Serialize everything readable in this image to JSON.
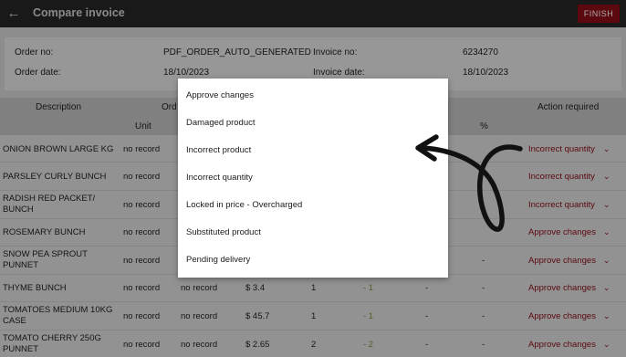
{
  "appbar": {
    "back_icon": "arrow-left-icon",
    "title": "Compare invoice",
    "finish_label": "FINISH"
  },
  "summary": {
    "order_no_label": "Order no:",
    "order_no": "PDF_ORDER_AUTO_GENERATED",
    "invoice_no_label": "Invoice no:",
    "invoice_no": "6234270",
    "order_date_label": "Order date:",
    "order_date": "18/10/2023",
    "invoice_date_label": "Invoice date:",
    "invoice_date": "18/10/2023"
  },
  "table": {
    "headers": {
      "description": "Description",
      "order_group": "Ord",
      "unit": "Unit",
      "percent": "%",
      "action": "Action required"
    },
    "rows": [
      {
        "description": "ONION BROWN LARGE KG",
        "unit": "no record",
        "action": "Incorrect quantity"
      },
      {
        "description": "PARSLEY CURLY BUNCH",
        "unit": "no record",
        "action": "Incorrect quantity"
      },
      {
        "description": "RADISH RED PACKET/ BUNCH",
        "unit": "no record",
        "action": "Incorrect quantity"
      },
      {
        "description": "ROSEMARY BUNCH",
        "unit": "no record",
        "action": "Approve changes"
      },
      {
        "description": "SNOW PEA SPROUT PUNNET",
        "unit": "no record",
        "dash2": "-",
        "action": "Approve changes"
      },
      {
        "description": "THYME BUNCH",
        "unit": "no record",
        "unit2": "no record",
        "price": "$ 3.4",
        "qty": "1",
        "pct": "- 1",
        "dash1": "-",
        "dash2": "-",
        "action": "Approve changes"
      },
      {
        "description": "TOMATOES MEDIUM 10KG CASE",
        "unit": "no record",
        "unit2": "no record",
        "price": "$ 45.7",
        "qty": "1",
        "pct": "- 1",
        "dash1": "-",
        "dash2": "-",
        "action": "Approve changes"
      },
      {
        "description": "TOMATO CHERRY 250G PUNNET",
        "unit": "no record",
        "unit2": "no record",
        "price": "$ 2.65",
        "qty": "2",
        "pct": "- 2",
        "dash1": "-",
        "dash2": "-",
        "action": "Approve changes"
      }
    ]
  },
  "menu": {
    "items": [
      "Approve changes",
      "Damaged product",
      "Incorrect product",
      "Incorrect quantity",
      "Locked in price - Overcharged",
      "Substituted product",
      "Pending delivery"
    ]
  },
  "chevron_icon": "chevron-down-icon",
  "annotation_icon": "curved-arrow-icon",
  "colors": {
    "appbar": "#262626",
    "accent_red": "#8a0e16",
    "menu_bg": "#ffffff"
  }
}
